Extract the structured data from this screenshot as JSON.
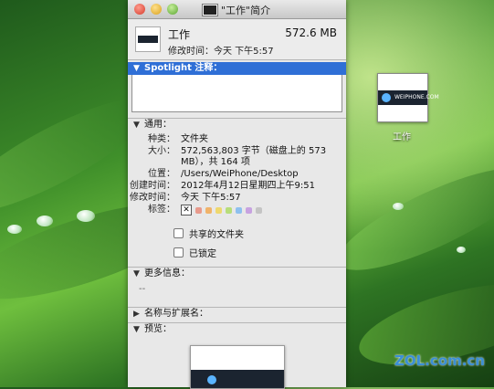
{
  "window": {
    "title": "\"工作\"简介"
  },
  "header": {
    "name": "工作",
    "size": "572.6 MB",
    "modified": "修改时间：今天 下午5:57"
  },
  "spotlight": {
    "title": "Spotlight 注释："
  },
  "general": {
    "title": "通用：",
    "rows": [
      {
        "k": "种类：",
        "v": "文件夹"
      },
      {
        "k": "大小：",
        "v": "572,563,803 字节（磁盘上的 573 MB），共 164 项"
      },
      {
        "k": "位置：",
        "v": "/Users/WeiPhone/Desktop"
      },
      {
        "k": "创建时间：",
        "v": "2012年4月12日星期四上午9:51"
      },
      {
        "k": "修改时间：",
        "v": "今天 下午5:57"
      }
    ],
    "tags_label": "标签：",
    "tag_colors": [
      "#e89a8c",
      "#f0b36a",
      "#eed86f",
      "#b7dd7a",
      "#8ec0ee",
      "#c7a2e0",
      "#c4c4c4"
    ],
    "shared": "共享的文件夹",
    "locked": "已锁定"
  },
  "more_info": {
    "title": "更多信息：",
    "value": "--"
  },
  "name_ext": {
    "title": "名称与扩展名："
  },
  "preview": {
    "title": "预览："
  },
  "desktop": {
    "folder_label": "工作",
    "logo_text": "WEIPHONE.COM"
  },
  "watermark": "ZOL.com.cn"
}
